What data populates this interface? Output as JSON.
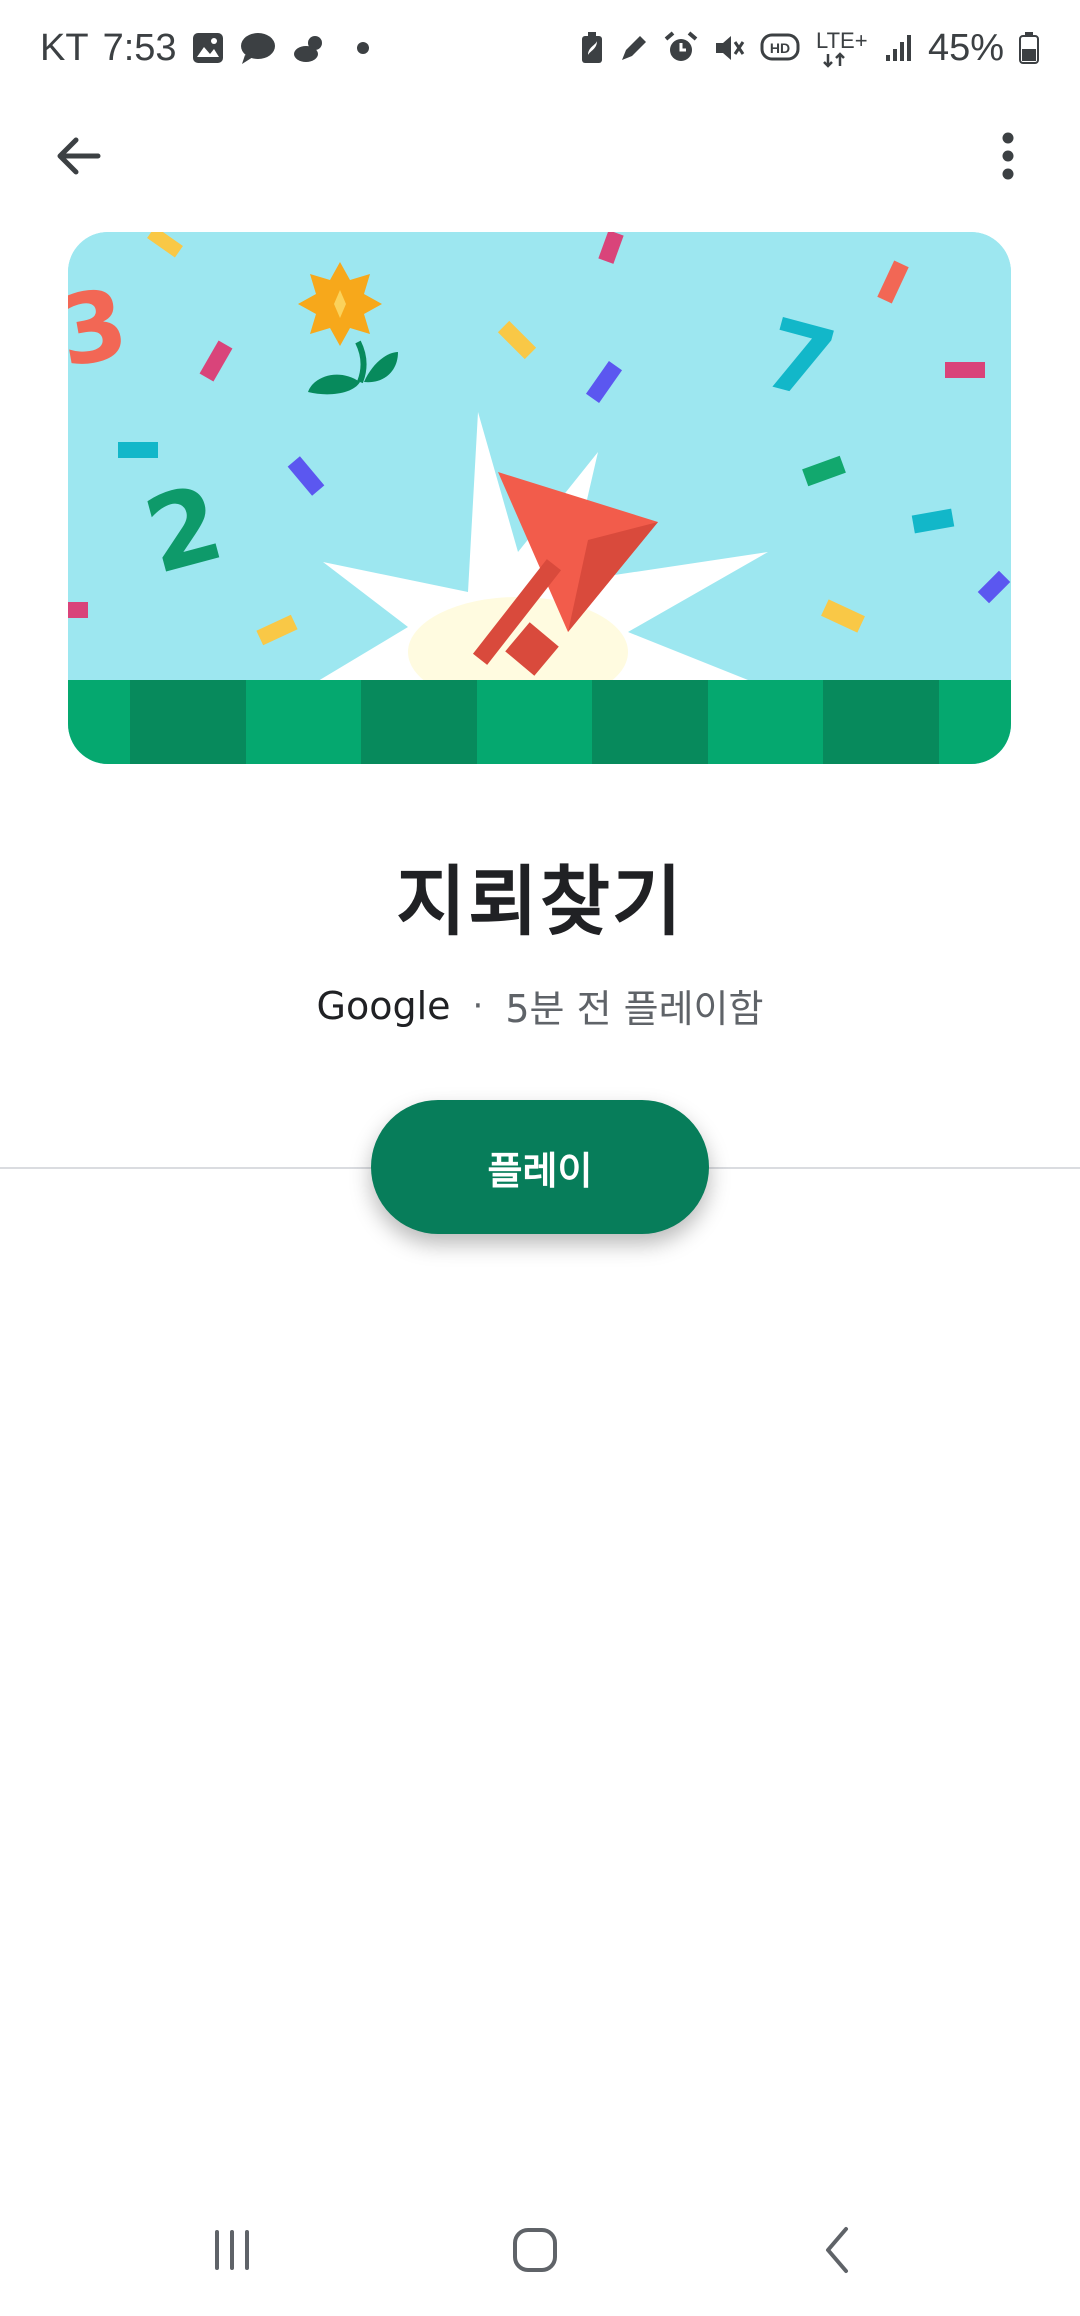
{
  "status_bar": {
    "carrier": "KT",
    "time": "7:53",
    "network": "LTE+",
    "battery": "45%",
    "icons_left": [
      "gallery-icon",
      "chat-icon",
      "weather-icon",
      "dot-icon"
    ],
    "icons_right": [
      "battery-saver-icon",
      "pen-icon",
      "alarm-icon",
      "mute-icon",
      "hd-voice-icon",
      "lte-icon",
      "signal-icon",
      "battery-icon"
    ]
  },
  "app_bar": {
    "back_icon": "arrow-back-icon",
    "more_icon": "more-vert-icon"
  },
  "hero": {
    "colors": {
      "sky": "#9de7f0",
      "grass_light": "#05a86f",
      "grass_dark": "#078a5c",
      "flag": "#f25c4b"
    },
    "numbers": [
      "3",
      "2",
      "7"
    ]
  },
  "game": {
    "title": "지뢰찾기",
    "publisher": "Google",
    "separator": "·",
    "last_played": "5분 전 플레이함"
  },
  "play_button": {
    "label": "플레이",
    "color": "#077d5a"
  },
  "nav_bar": {
    "items": [
      "recent-apps-icon",
      "home-icon",
      "back-icon"
    ]
  }
}
